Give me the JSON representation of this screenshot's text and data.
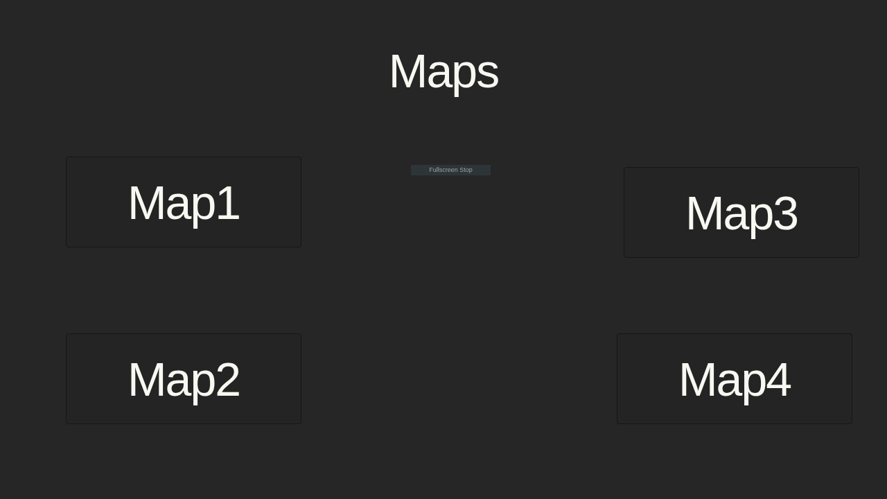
{
  "title": "Maps",
  "toolbar_button": {
    "label": "Fullscreen Stop"
  },
  "maps": [
    {
      "label": "Map1"
    },
    {
      "label": "Map2"
    },
    {
      "label": "Map3"
    },
    {
      "label": "Map4"
    }
  ]
}
